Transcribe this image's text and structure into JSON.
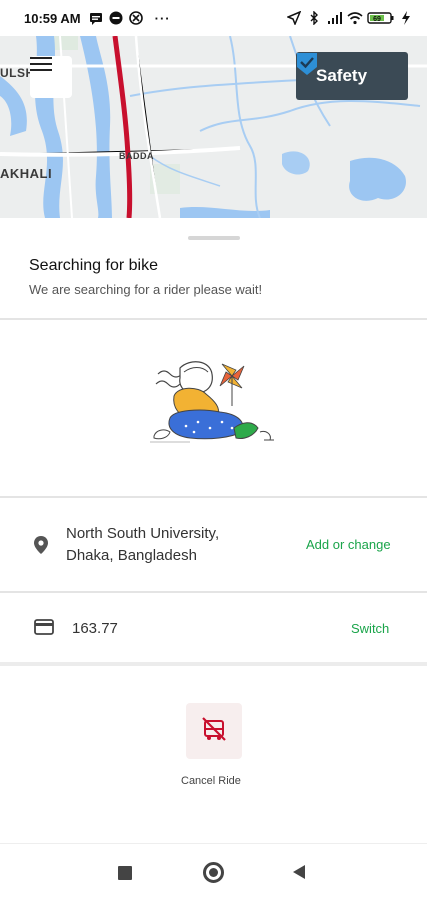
{
  "status_bar": {
    "time": "10:59 AM",
    "dots": "···",
    "battery_level": "69"
  },
  "map": {
    "labels": {
      "left_top": "ULSHA",
      "center": "BADDA",
      "left_bottom": "AKHALI"
    }
  },
  "header": {
    "safety_label": "Safety"
  },
  "search": {
    "title": "Searching for bike",
    "subtitle": "We are searching for a rider please wait!"
  },
  "pickup": {
    "address_line1": "North South University,",
    "address_line2": "Dhaka, Bangladesh",
    "action_label": "Add or change"
  },
  "payment": {
    "fare": "163.77",
    "action_label": "Switch"
  },
  "cancel": {
    "label": "Cancel Ride"
  },
  "colors": {
    "accent_green": "#1aa44a",
    "safety_bg": "#3b4a55",
    "safety_check": "#2d8fd6",
    "route_red": "#c8102e",
    "cancel_icon": "#c8102e"
  }
}
